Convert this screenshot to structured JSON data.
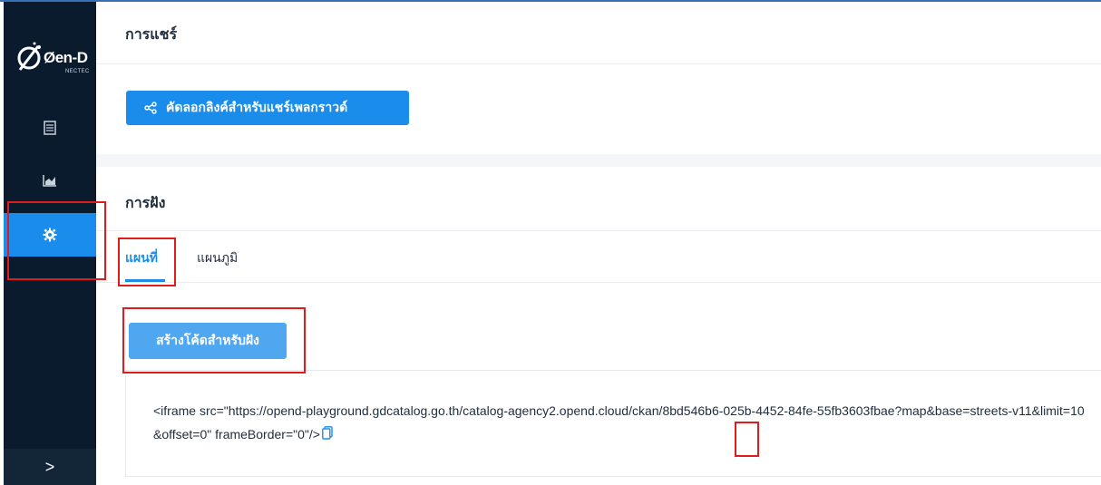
{
  "sidebar": {
    "logo_text": "Øen-D",
    "logo_sub": "NECTEC",
    "items": [
      {
        "icon": "list-icon"
      },
      {
        "icon": "chart-icon"
      },
      {
        "icon": "gear-icon",
        "active": true
      }
    ],
    "expand_label": ">"
  },
  "share": {
    "title": "การแชร์",
    "button_label": "คัดลอกลิงค์สำหรับแชร์เพลกราวด์"
  },
  "embed": {
    "title": "การฝัง",
    "tabs": [
      {
        "label": "แผนที่",
        "active": true
      },
      {
        "label": "แผนภูมิ",
        "active": false
      }
    ],
    "generate_button": "สร้างโค้ดสำหรับฝัง",
    "code": "<iframe src=\"https://opend-playground.gdcatalog.go.th/catalog-agency2.opend.cloud/ckan/8bd546b6-025b-4452-84fe-55fb3603fbae?map&base=streets-v11&limit=10&offset=0\" frameBorder=\"0\"/>"
  },
  "colors": {
    "accent": "#1a8dec",
    "sidebar": "#0b1b2e",
    "highlight": "#e01b1b"
  }
}
